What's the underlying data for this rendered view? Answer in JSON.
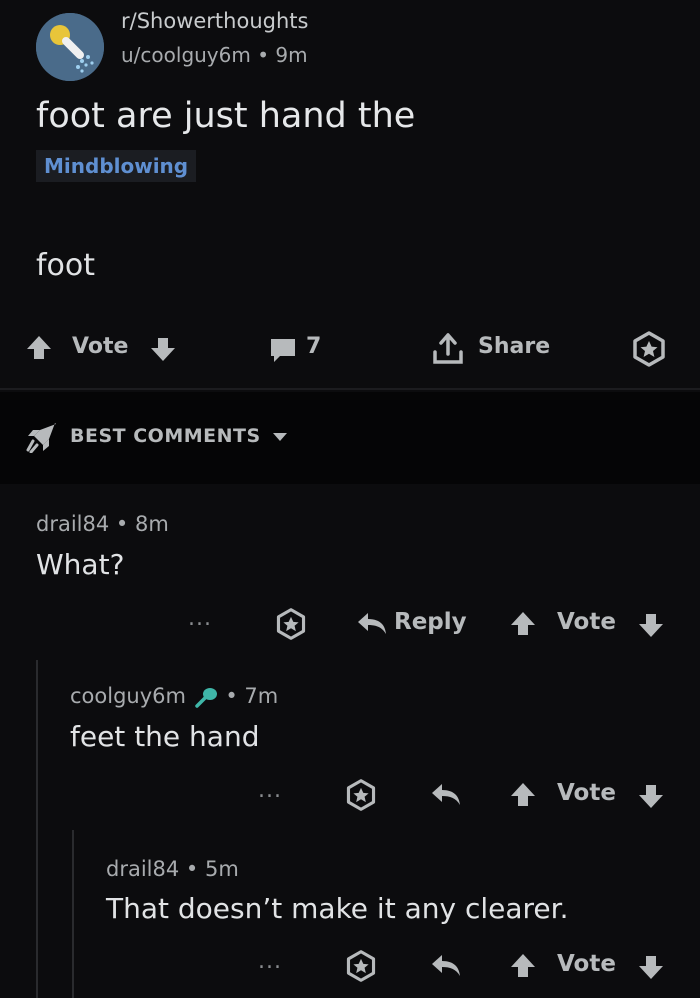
{
  "post": {
    "subreddit": "r/Showerthoughts",
    "author": "u/coolguy6m",
    "separator": "•",
    "age": "9m",
    "title": "foot are just hand the",
    "flair": "Mindblowing",
    "body": "foot",
    "actions": {
      "vote_label": "Vote",
      "comment_count": "7",
      "share_label": "Share"
    }
  },
  "sort": {
    "label": "BEST COMMENTS"
  },
  "comments": [
    {
      "author": "drail84",
      "separator": "•",
      "age": "8m",
      "body": "What?",
      "more": "...",
      "reply_label": "Reply",
      "vote_label": "Vote"
    },
    {
      "author": "coolguy6m",
      "separator": "•",
      "age": "7m",
      "body": "feet the hand",
      "more": "...",
      "vote_label": "Vote"
    },
    {
      "author": "drail84",
      "separator": "•",
      "age": "5m",
      "body": "That doesn’t make it any clearer.",
      "more": "...",
      "vote_label": "Vote"
    }
  ],
  "colors": {
    "background": "#0c0c0e",
    "band": "#050506",
    "op_username": "#5f8fd1",
    "flair_text": "#5f8fd1",
    "mic_icon": "#3fb6a8"
  },
  "icons": [
    "subreddit-avatar-icon",
    "upvote-icon",
    "downvote-icon",
    "comment-icon",
    "share-icon",
    "award-icon",
    "rocket-icon",
    "chevron-down-icon",
    "reply-icon",
    "mic-icon"
  ]
}
